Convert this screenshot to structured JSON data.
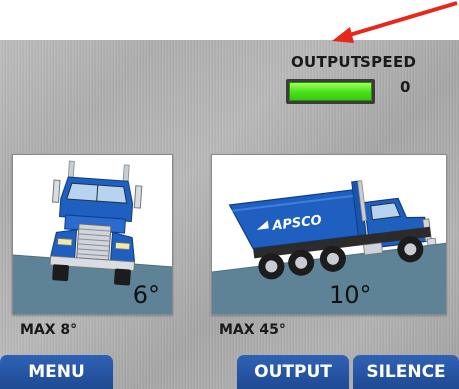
{
  "header": {
    "output_label": "OUTPUT",
    "speed_label": "SPEED",
    "speed_value": "0",
    "output_active": true
  },
  "panels": {
    "front": {
      "angle": "6°",
      "max": "MAX 8°"
    },
    "side": {
      "angle": "10°",
      "max": "MAX 45°",
      "brand": "APSCO"
    }
  },
  "buttons": {
    "menu": "MENU",
    "output": "OUTPUT",
    "silence": "SILENCE"
  },
  "colors": {
    "indicator_on": "#4ee21d",
    "button_blue": "#2a5aa8",
    "ground": "#5f8396",
    "arrow": "#e8261a",
    "truck_blue": "#1e5fc0"
  }
}
